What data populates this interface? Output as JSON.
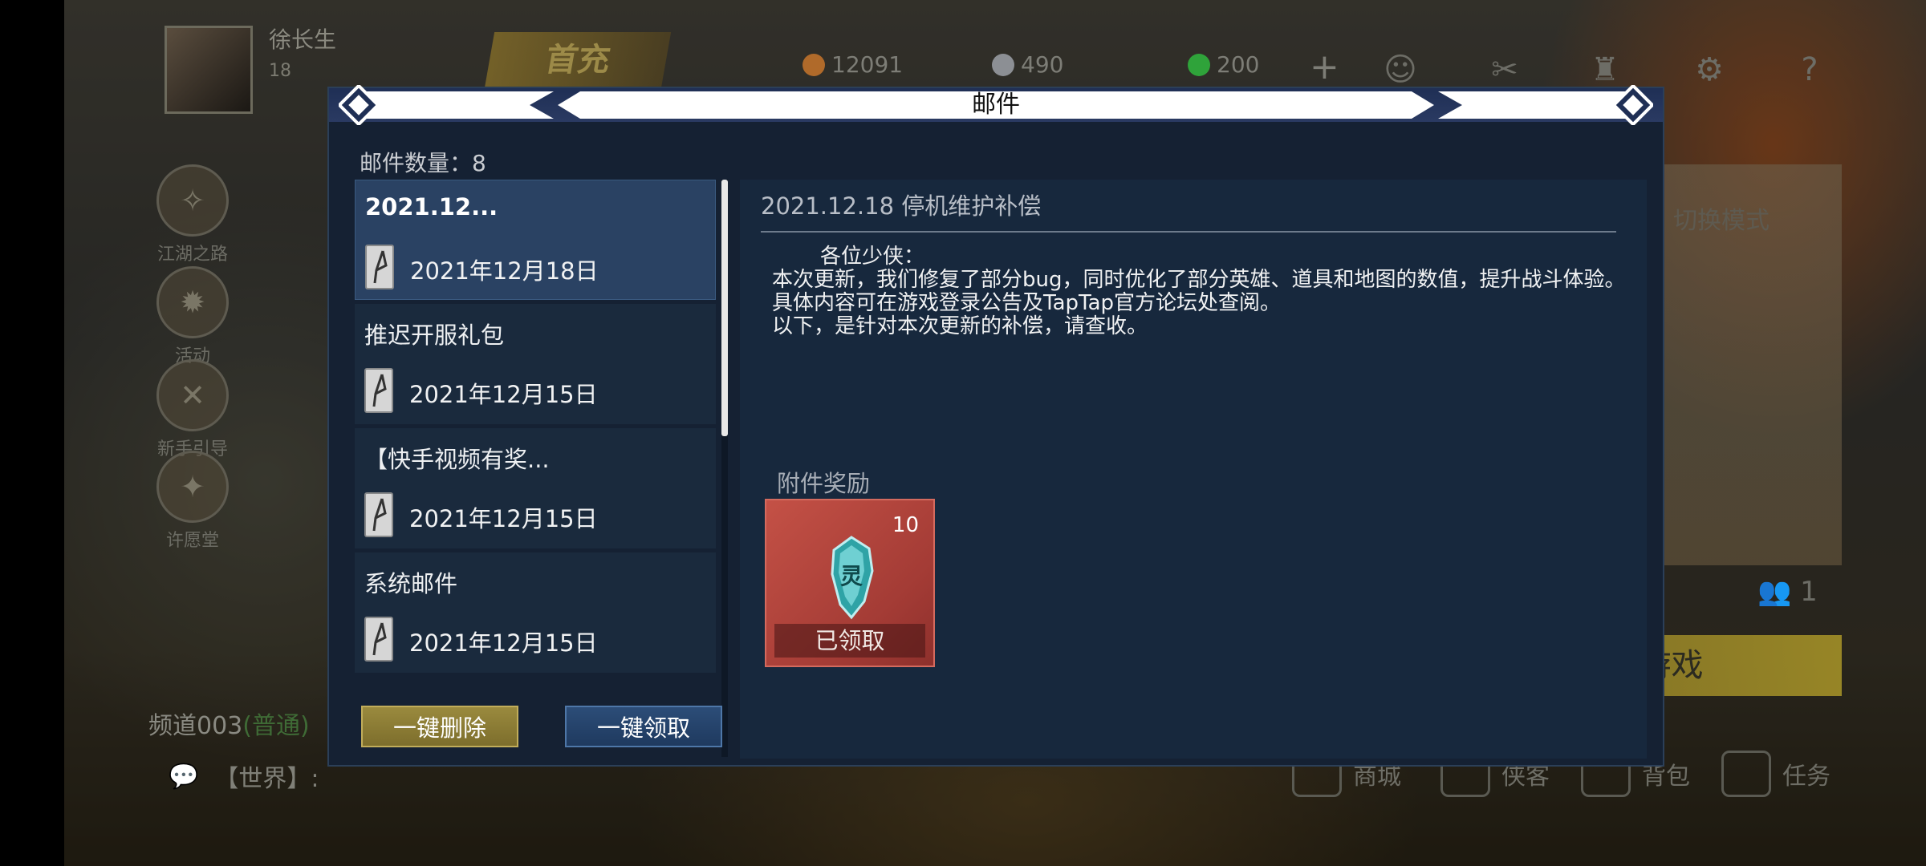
{
  "hud": {
    "player_name": "徐长生",
    "player_level": "18",
    "first_recharge": "首充",
    "resources": [
      {
        "icon": "copper-coin-icon",
        "value": "12091",
        "color": "#b06a2a"
      },
      {
        "icon": "silver-ingot-icon",
        "value": "490",
        "color": "#8c8f94"
      },
      {
        "icon": "jade-icon",
        "value": "200",
        "color": "#2fa33a"
      }
    ],
    "plus": "+"
  },
  "side_menu": [
    {
      "label": "江湖之路",
      "icon": "compass-icon",
      "glyph": "✧"
    },
    {
      "label": "活动",
      "icon": "flame-icon",
      "glyph": "✹"
    },
    {
      "label": "新手引导",
      "icon": "crossed-swords-icon",
      "glyph": "✕"
    },
    {
      "label": "许愿堂",
      "icon": "wish-icon",
      "glyph": "✦"
    }
  ],
  "channel": {
    "name": "频道003",
    "type": "(普通)"
  },
  "world_chat": "【世界】:",
  "right_panel": {
    "switch_mode": "切换模式",
    "team_count": "1",
    "start_game": "开始游戏"
  },
  "bottom_nav": [
    {
      "label": "商城",
      "icon": "shop-icon"
    },
    {
      "label": "侠客",
      "icon": "hero-icon"
    },
    {
      "label": "背包",
      "icon": "bag-icon"
    },
    {
      "label": "任务",
      "icon": "task-scroll-icon"
    }
  ],
  "dialog": {
    "title": "邮件",
    "mail_count_label": "邮件数量：",
    "mail_count": "8",
    "mails": [
      {
        "subject": "2021.12...",
        "date": "2021年12月18日",
        "selected": true
      },
      {
        "subject": "推迟开服礼包",
        "date": "2021年12月15日",
        "selected": false
      },
      {
        "subject": "【快手视频有奖...",
        "date": "2021年12月15日",
        "selected": false
      },
      {
        "subject": "系统邮件",
        "date": "2021年12月15日",
        "selected": false
      }
    ],
    "detail": {
      "title": "2021.12.18 停机维护补偿",
      "greeting": "各位少侠：",
      "lines": [
        "本次更新，我们修复了部分bug，同时优化了部分英雄、道具和地图的数值，提升战斗体验。具体内容可在游戏登录公告及TapTap官方论坛处查阅。",
        "以下，是针对本次更新的补偿，请查收。"
      ],
      "attachment_label": "附件奖励",
      "reward": {
        "quantity": "10",
        "status": "已领取",
        "icon": "spirit-token-icon"
      }
    },
    "buttons": {
      "delete_all": "一键删除",
      "claim_all": "一键领取"
    }
  }
}
